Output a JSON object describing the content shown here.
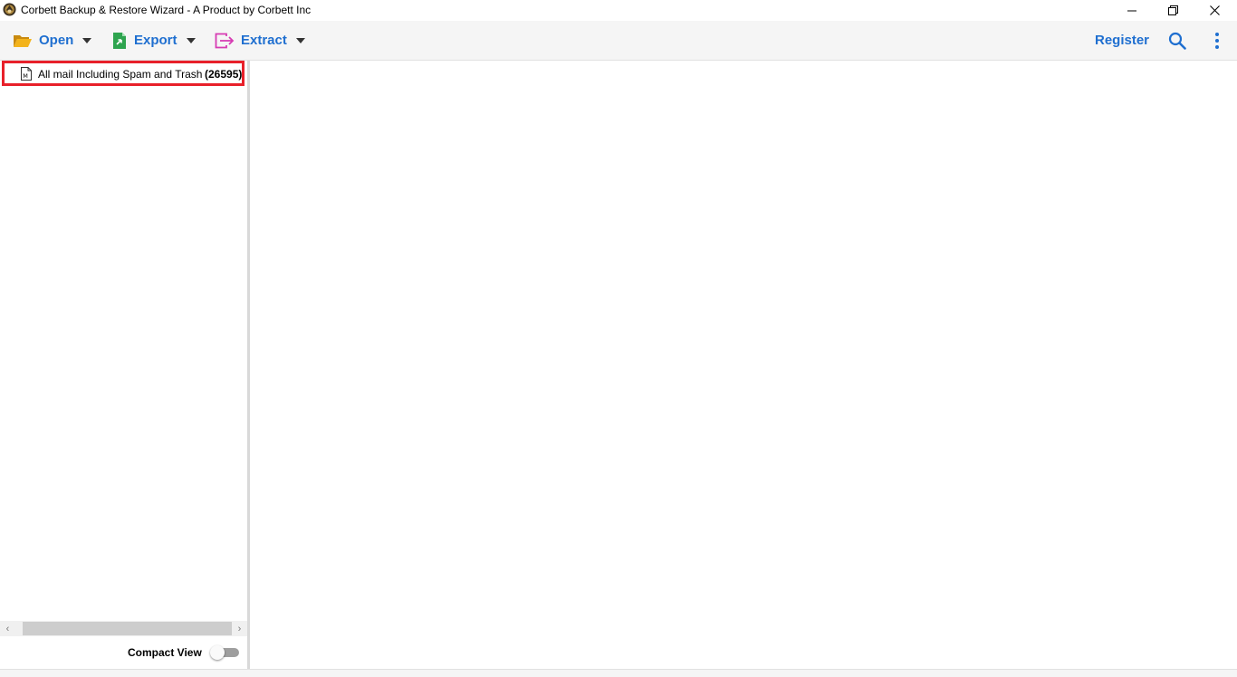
{
  "window": {
    "title": "Corbett Backup & Restore Wizard - A Product by Corbett Inc",
    "controls": [
      "minimize",
      "restore",
      "close"
    ]
  },
  "toolbar": {
    "open_label": "Open",
    "export_label": "Export",
    "extract_label": "Extract",
    "register_label": "Register",
    "colors": {
      "accent": "#1f6fd0",
      "open_icon": "#e8a417",
      "export_icon": "#2ea44f",
      "extract_icon": "#d63bb3"
    }
  },
  "sidebar": {
    "items": [
      {
        "label": "All mail Including Spam and Trash",
        "count": "(26595)",
        "icon": "mbox-file-icon",
        "highlighted": true,
        "highlight_color": "#e8202a"
      }
    ],
    "compact_view_label": "Compact View",
    "compact_view_on": false
  }
}
